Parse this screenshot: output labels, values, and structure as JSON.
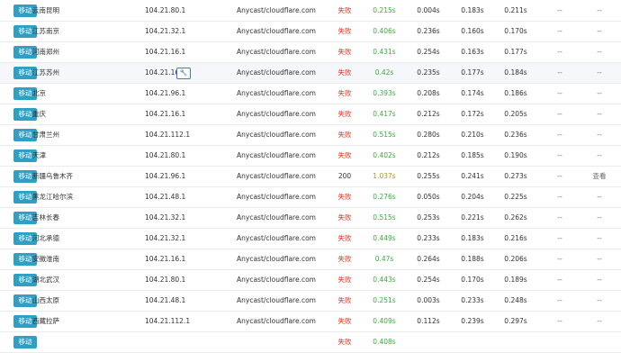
{
  "table": {
    "rows": [
      {
        "isp": "移动",
        "location": "云南昆明",
        "ip": "104.21.80.1",
        "resolve": "Anycast/cloudflare.com",
        "status": "失败",
        "t_total": "0.215s",
        "t_dns": "0.004s",
        "t_connect": "0.183s",
        "t_download": "0.211s",
        "col9": "--",
        "col10": "--"
      },
      {
        "isp": "移动",
        "location": "江苏南京",
        "ip": "104.21.32.1",
        "resolve": "Anycast/cloudflare.com",
        "status": "失败",
        "t_total": "0.406s",
        "t_dns": "0.236s",
        "t_connect": "0.160s",
        "t_download": "0.170s",
        "col9": "--",
        "col10": "--"
      },
      {
        "isp": "移动",
        "location": "河南郑州",
        "ip": "104.21.16.1",
        "resolve": "Anycast/cloudflare.com",
        "status": "失败",
        "t_total": "0.431s",
        "t_dns": "0.254s",
        "t_connect": "0.163s",
        "t_download": "0.177s",
        "col9": "--",
        "col10": "--"
      },
      {
        "isp": "移动",
        "location": "江苏苏州",
        "ip": "104.21.16.1",
        "resolve": "Anycast/cloudflare.com",
        "status": "失败",
        "t_total": "0.42s",
        "t_dns": "0.235s",
        "t_connect": "0.177s",
        "t_download": "0.184s",
        "col9": "--",
        "col10": "--"
      },
      {
        "isp": "移动",
        "location": "北京",
        "ip": "104.21.96.1",
        "resolve": "Anycast/cloudflare.com",
        "status": "失败",
        "t_total": "0.393s",
        "t_dns": "0.208s",
        "t_connect": "0.174s",
        "t_download": "0.186s",
        "col9": "--",
        "col10": "--"
      },
      {
        "isp": "移动",
        "location": "重庆",
        "ip": "104.21.16.1",
        "resolve": "Anycast/cloudflare.com",
        "status": "失败",
        "t_total": "0.417s",
        "t_dns": "0.212s",
        "t_connect": "0.172s",
        "t_download": "0.205s",
        "col9": "--",
        "col10": "--"
      },
      {
        "isp": "移动",
        "location": "甘肃兰州",
        "ip": "104.21.112.1",
        "resolve": "Anycast/cloudflare.com",
        "status": "失败",
        "t_total": "0.515s",
        "t_dns": "0.280s",
        "t_connect": "0.210s",
        "t_download": "0.236s",
        "col9": "--",
        "col10": "--"
      },
      {
        "isp": "移动",
        "location": "天津",
        "ip": "104.21.80.1",
        "resolve": "Anycast/cloudflare.com",
        "status": "失败",
        "t_total": "0.402s",
        "t_dns": "0.212s",
        "t_connect": "0.185s",
        "t_download": "0.190s",
        "col9": "--",
        "col10": "--"
      },
      {
        "isp": "移动",
        "location": "新疆乌鲁木齐",
        "ip": "104.21.96.1",
        "resolve": "Anycast/cloudflare.com",
        "status": "200",
        "t_total": "1.037s",
        "t_dns": "0.255s",
        "t_connect": "0.241s",
        "t_download": "0.273s",
        "col9": "--",
        "col10": "查看"
      },
      {
        "isp": "移动",
        "location": "黑龙江哈尔滨",
        "ip": "104.21.48.1",
        "resolve": "Anycast/cloudflare.com",
        "status": "失败",
        "t_total": "0.276s",
        "t_dns": "0.050s",
        "t_connect": "0.204s",
        "t_download": "0.225s",
        "col9": "--",
        "col10": "--"
      },
      {
        "isp": "移动",
        "location": "吉林长春",
        "ip": "104.21.32.1",
        "resolve": "Anycast/cloudflare.com",
        "status": "失败",
        "t_total": "0.515s",
        "t_dns": "0.253s",
        "t_connect": "0.221s",
        "t_download": "0.262s",
        "col9": "--",
        "col10": "--"
      },
      {
        "isp": "移动",
        "location": "河北承德",
        "ip": "104.21.32.1",
        "resolve": "Anycast/cloudflare.com",
        "status": "失败",
        "t_total": "0.449s",
        "t_dns": "0.233s",
        "t_connect": "0.183s",
        "t_download": "0.216s",
        "col9": "--",
        "col10": "--"
      },
      {
        "isp": "移动",
        "location": "安徽淮南",
        "ip": "104.21.16.1",
        "resolve": "Anycast/cloudflare.com",
        "status": "失败",
        "t_total": "0.47s",
        "t_dns": "0.264s",
        "t_connect": "0.188s",
        "t_download": "0.206s",
        "col9": "--",
        "col10": "--"
      },
      {
        "isp": "移动",
        "location": "湖北武汉",
        "ip": "104.21.80.1",
        "resolve": "Anycast/cloudflare.com",
        "status": "失败",
        "t_total": "0.443s",
        "t_dns": "0.254s",
        "t_connect": "0.170s",
        "t_download": "0.189s",
        "col9": "--",
        "col10": "--"
      },
      {
        "isp": "移动",
        "location": "山西太原",
        "ip": "104.21.48.1",
        "resolve": "Anycast/cloudflare.com",
        "status": "失败",
        "t_total": "0.251s",
        "t_dns": "0.003s",
        "t_connect": "0.233s",
        "t_download": "0.248s",
        "col9": "--",
        "col10": "--"
      },
      {
        "isp": "移动",
        "location": "西藏拉萨",
        "ip": "104.21.112.1",
        "resolve": "Anycast/cloudflare.com",
        "status": "失败",
        "t_total": "0.409s",
        "t_dns": "0.112s",
        "t_connect": "0.239s",
        "t_download": "0.297s",
        "col9": "--",
        "col10": "--"
      },
      {
        "isp": "移动",
        "location": "",
        "ip": "",
        "resolve": "",
        "status": "失败",
        "t_total": "0.408s",
        "t_dns": "",
        "t_connect": "",
        "t_download": "",
        "col9": "",
        "col10": ""
      }
    ],
    "highlighted_row": 3,
    "tool_icon": "wrench-icon",
    "colors": {
      "isp_badge": "#2f9fc4",
      "fail": "#e0301e",
      "fast": "#3cac3c",
      "slow": "#a49a1c",
      "hover_row": "#f5f7fb"
    }
  }
}
